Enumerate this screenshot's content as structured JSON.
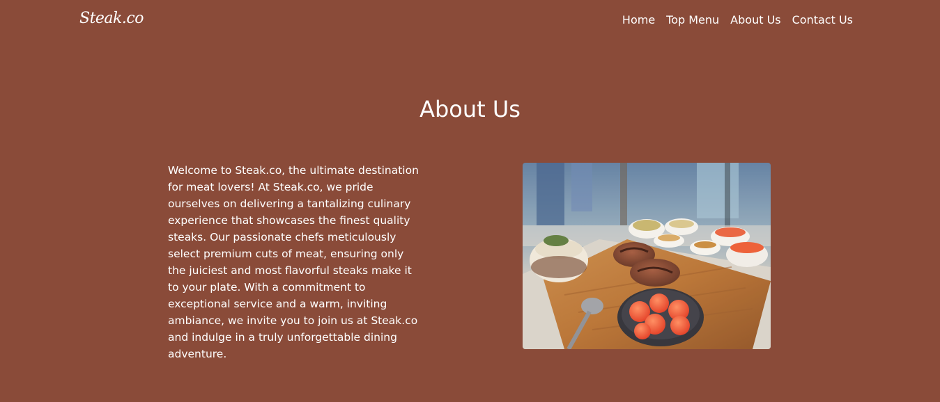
{
  "navbar": {
    "brand": "Steak.co",
    "links": [
      "Home",
      "Top Menu",
      "About Us",
      "Contact Us"
    ]
  },
  "about": {
    "title": "About Us",
    "body": "Welcome to Steak.co, the ultimate destination for meat lovers! At Steak.co, we pride ourselves on delivering a tantalizing culinary experience that showcases the finest quality steaks. Our passionate chefs meticulously select premium cuts of meat, ensuring only the juiciest and most flavorful steaks make it to your plate. With a commitment to exceptional service and a warm, inviting ambiance, we invite you to join us at Steak.co and indulge in a truly unforgettable dining adventure."
  },
  "colors": {
    "background": "#8a4b39",
    "text": "#ffffff"
  }
}
